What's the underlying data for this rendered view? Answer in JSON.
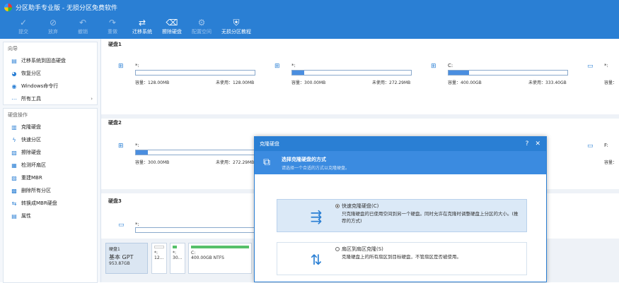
{
  "window": {
    "title": "分区助手专业版 - 无损分区免费软件"
  },
  "toolbar": {
    "commit": "提交",
    "discard": "放弃",
    "undo": "撤销",
    "redo": "重做",
    "migrate": "迁移系统",
    "erase": "擦除硬盘",
    "config": "配置空间",
    "tutorial": "无损分区教程"
  },
  "sidebar": {
    "wizard_title": "向导",
    "wizard_items": [
      "迁移系统到固态硬盘",
      "恢复分区",
      "Windows命令行",
      "所有工具"
    ],
    "disk_title": "硬盘操作",
    "disk_items": [
      "克隆硬盘",
      "快速分区",
      "擦除硬盘",
      "检测坏扇区",
      "重建MBR",
      "删除所有分区",
      "转换成MBR硬盘",
      "属性"
    ]
  },
  "disks": [
    {
      "label": "硬盘1",
      "parts": [
        {
          "name": "*:",
          "cap": "容量：128.00MB",
          "free": "未使用：128.00MB",
          "fill": 0.0
        },
        {
          "name": "*:",
          "cap": "容量：300.00MB",
          "free": "未使用：272.29MB",
          "fill": 0.1
        },
        {
          "name": "C:",
          "cap": "容量：400.00GB",
          "free": "未使用：333.40GB",
          "fill": 0.17
        },
        {
          "name": "*:",
          "cap": "容量：",
          "free": "",
          "fill": 0.0
        }
      ]
    },
    {
      "label": "硬盘2",
      "parts": [
        {
          "name": "*:",
          "cap": "容量：300.00MB",
          "free": "未使用：272.29MB",
          "fill": 0.1
        },
        {
          "name": "F:",
          "cap": "容量：",
          "free": "",
          "fill": 0.0
        }
      ]
    },
    {
      "label": "硬盘3",
      "parts": [
        {
          "name": "*:",
          "cap": "",
          "free": "",
          "fill": 0.0
        }
      ]
    }
  ],
  "diskmap": {
    "name": "硬盘1",
    "type": "基本 GPT",
    "size": "953.87GB",
    "blocks": [
      {
        "name": "*:",
        "size": "12..."
      },
      {
        "name": "*:",
        "size": "30..."
      },
      {
        "name": "C:",
        "size": "400.00GB NTFS"
      }
    ]
  },
  "dialog": {
    "title": "克隆硬盘",
    "head_title": "选择克隆硬盘的方式",
    "head_sub": "请选择一个合适的方式以克隆硬盘。",
    "opt1_title": "快速克隆硬盘(C)",
    "opt1_desc": "只克隆硬盘的已使用空间到另一个硬盘。同时允许在克隆时调整硬盘上分区的大小。(推荐的方式)",
    "opt2_title": "扇区到扇区克隆(S)",
    "opt2_desc": "克隆硬盘上的所有扇区到目标硬盘，不管扇区是否被使用。",
    "help": "?",
    "close": "✕"
  }
}
